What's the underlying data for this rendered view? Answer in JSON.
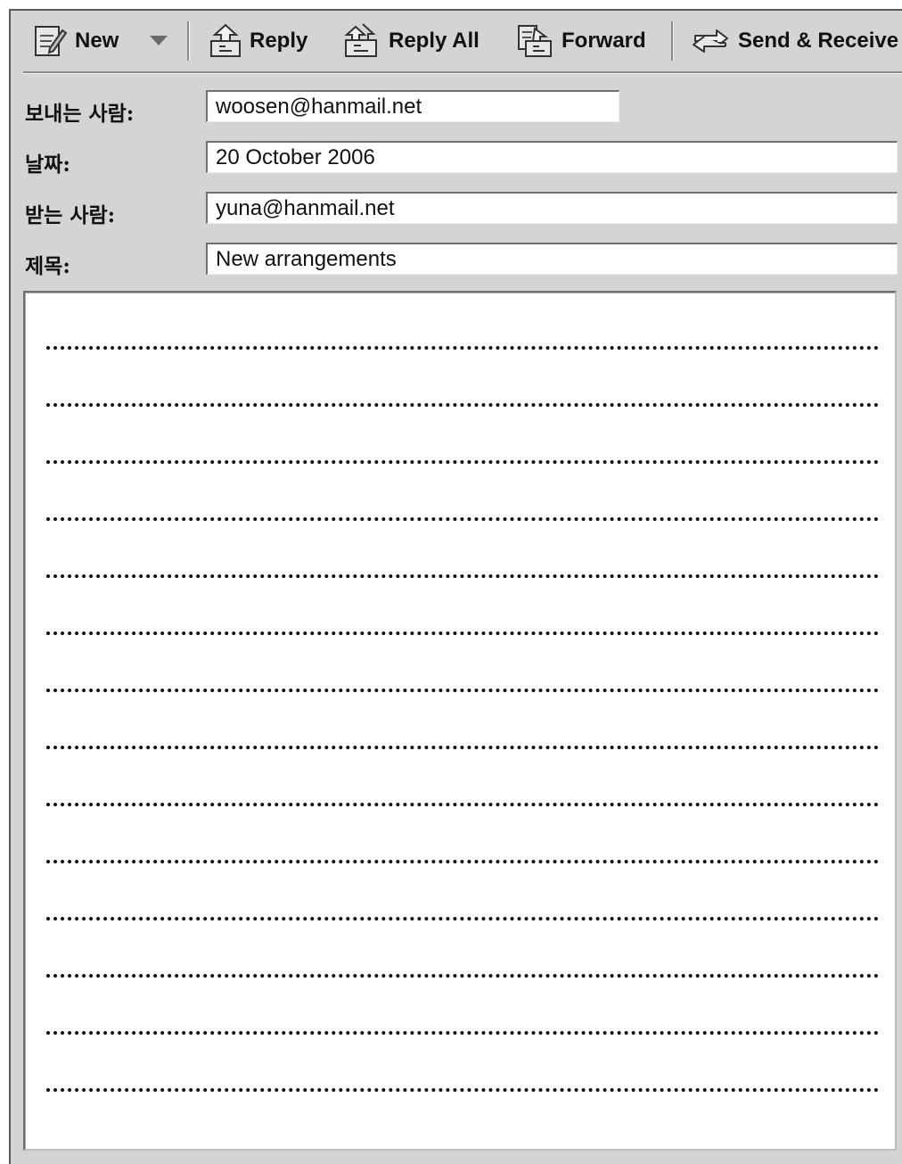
{
  "toolbar": {
    "new_label": "New",
    "reply_label": "Reply",
    "reply_all_label": "Reply All",
    "forward_label": "Forward",
    "send_receive_label": "Send & Receive"
  },
  "header": {
    "from_label": "보내는 사람:",
    "from_value": "woosen@hanmail.net",
    "date_label": "날짜:",
    "date_value": "20 October 2006",
    "to_label": "받는 사람:",
    "to_value": "yuna@hanmail.net",
    "subject_label": "제목:",
    "subject_value": "New arrangements"
  },
  "body": {
    "line_count": 14
  },
  "icons": {
    "new": "compose-icon",
    "dropdown": "dropdown-arrow-icon",
    "reply": "reply-icon",
    "reply_all": "reply-all-icon",
    "forward": "forward-icon",
    "send_receive": "send-receive-icon"
  }
}
